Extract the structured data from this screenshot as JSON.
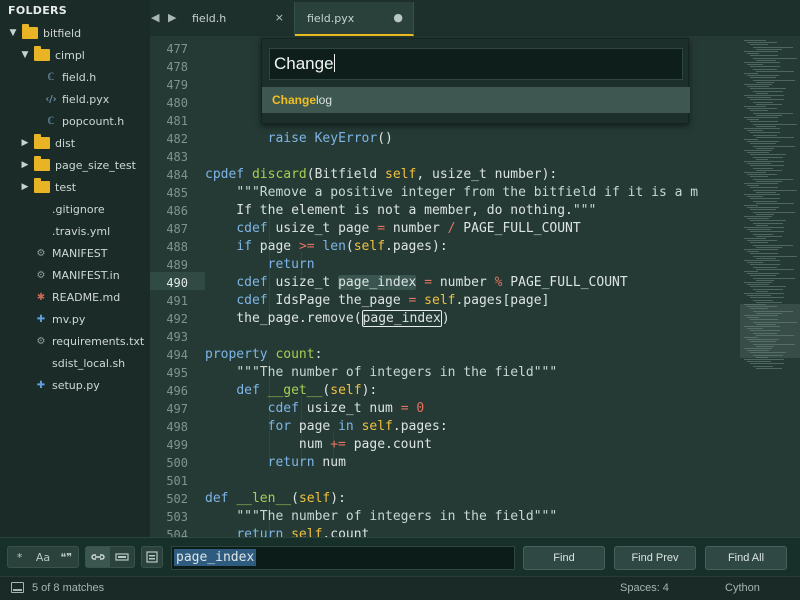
{
  "sidebar": {
    "header": "FOLDERS",
    "items": [
      {
        "label": "bitfield",
        "type": "folder",
        "state": "open"
      },
      {
        "label": "cimpl",
        "type": "folder",
        "state": "open"
      },
      {
        "label": "field.h",
        "type": "file",
        "icon": "c-header-icon"
      },
      {
        "label": "field.pyx",
        "type": "file",
        "icon": "code-file-icon"
      },
      {
        "label": "popcount.h",
        "type": "file",
        "icon": "c-header-icon"
      },
      {
        "label": "dist",
        "type": "folder",
        "state": "closed"
      },
      {
        "label": "page_size_test",
        "type": "folder",
        "state": "closed"
      },
      {
        "label": "test",
        "type": "folder",
        "state": "closed"
      },
      {
        "label": ".gitignore",
        "type": "file",
        "icon": ""
      },
      {
        "label": ".travis.yml",
        "type": "file",
        "icon": ""
      },
      {
        "label": "MANIFEST",
        "type": "file",
        "icon": "gear-icon"
      },
      {
        "label": "MANIFEST.in",
        "type": "file",
        "icon": "gear-icon"
      },
      {
        "label": "README.md",
        "type": "file",
        "icon": "star-icon"
      },
      {
        "label": "mv.py",
        "type": "file",
        "icon": "python-icon"
      },
      {
        "label": "requirements.txt",
        "type": "file",
        "icon": "gear-icon"
      },
      {
        "label": "sdist_local.sh",
        "type": "file",
        "icon": ""
      },
      {
        "label": "setup.py",
        "type": "file",
        "icon": "python-icon"
      }
    ]
  },
  "tabs": [
    {
      "label": "field.h",
      "control": "×",
      "active": false
    },
    {
      "label": "field.pyx",
      "control": "●",
      "active": true
    }
  ],
  "nav": {
    "back": "◀",
    "forward": "▶"
  },
  "editor": {
    "current_line": 490,
    "lines": [
      {
        "n": "477",
        "text": ""
      },
      {
        "n": "478",
        "text": ""
      },
      {
        "n": "479",
        "text": ""
      },
      {
        "n": "480",
        "text": ""
      },
      {
        "n": "481",
        "text": ""
      },
      {
        "n": "482",
        "text": "        raise KeyError()"
      },
      {
        "n": "483",
        "text": ""
      },
      {
        "n": "484",
        "text": "cpdef discard(Bitfield self, usize_t number):"
      },
      {
        "n": "485",
        "text": "    \"\"\"Remove a positive integer from the bitfield if it is a m"
      },
      {
        "n": "486",
        "text": "    If the element is not a member, do nothing.\"\"\""
      },
      {
        "n": "487",
        "text": "    cdef usize_t page = number / PAGE_FULL_COUNT"
      },
      {
        "n": "488",
        "text": "    if page >= len(self.pages):"
      },
      {
        "n": "489",
        "text": "        return"
      },
      {
        "n": "490",
        "text": "    cdef usize_t page_index = number % PAGE_FULL_COUNT"
      },
      {
        "n": "491",
        "text": "    cdef IdsPage the_page = self.pages[page]"
      },
      {
        "n": "492",
        "text": "    the_page.remove(page_index)"
      },
      {
        "n": "493",
        "text": ""
      },
      {
        "n": "494",
        "text": "property count:"
      },
      {
        "n": "495",
        "text": "    \"\"\"The number of integers in the field\"\"\""
      },
      {
        "n": "496",
        "text": "    def __get__(self):"
      },
      {
        "n": "497",
        "text": "        cdef usize_t num = 0"
      },
      {
        "n": "498",
        "text": "        for page in self.pages:"
      },
      {
        "n": "499",
        "text": "            num += page.count"
      },
      {
        "n": "500",
        "text": "        return num"
      },
      {
        "n": "501",
        "text": ""
      },
      {
        "n": "502",
        "text": "def __len__(self):"
      },
      {
        "n": "503",
        "text": "    \"\"\"The number of integers in the field\"\"\""
      },
      {
        "n": "504",
        "text": "    return self.count"
      }
    ]
  },
  "goto": {
    "query": "Change",
    "result_match": "Change",
    "result_rest": "log"
  },
  "find": {
    "options": [
      "*",
      "Aa",
      "❝❞",
      "🔗",
      "▭",
      "☰"
    ],
    "query": "page_index",
    "buttons": {
      "find": "Find",
      "find_prev": "Find Prev",
      "find_all": "Find All"
    }
  },
  "status": {
    "matches": "5 of 8 matches",
    "spaces": "Spaces: 4",
    "syntax": "Cython"
  },
  "colors": {
    "accent": "#f0c020",
    "keyword": "#7eb5e6",
    "function": "#f0c040",
    "operator": "#e3735f",
    "definition": "#a6cf52"
  }
}
